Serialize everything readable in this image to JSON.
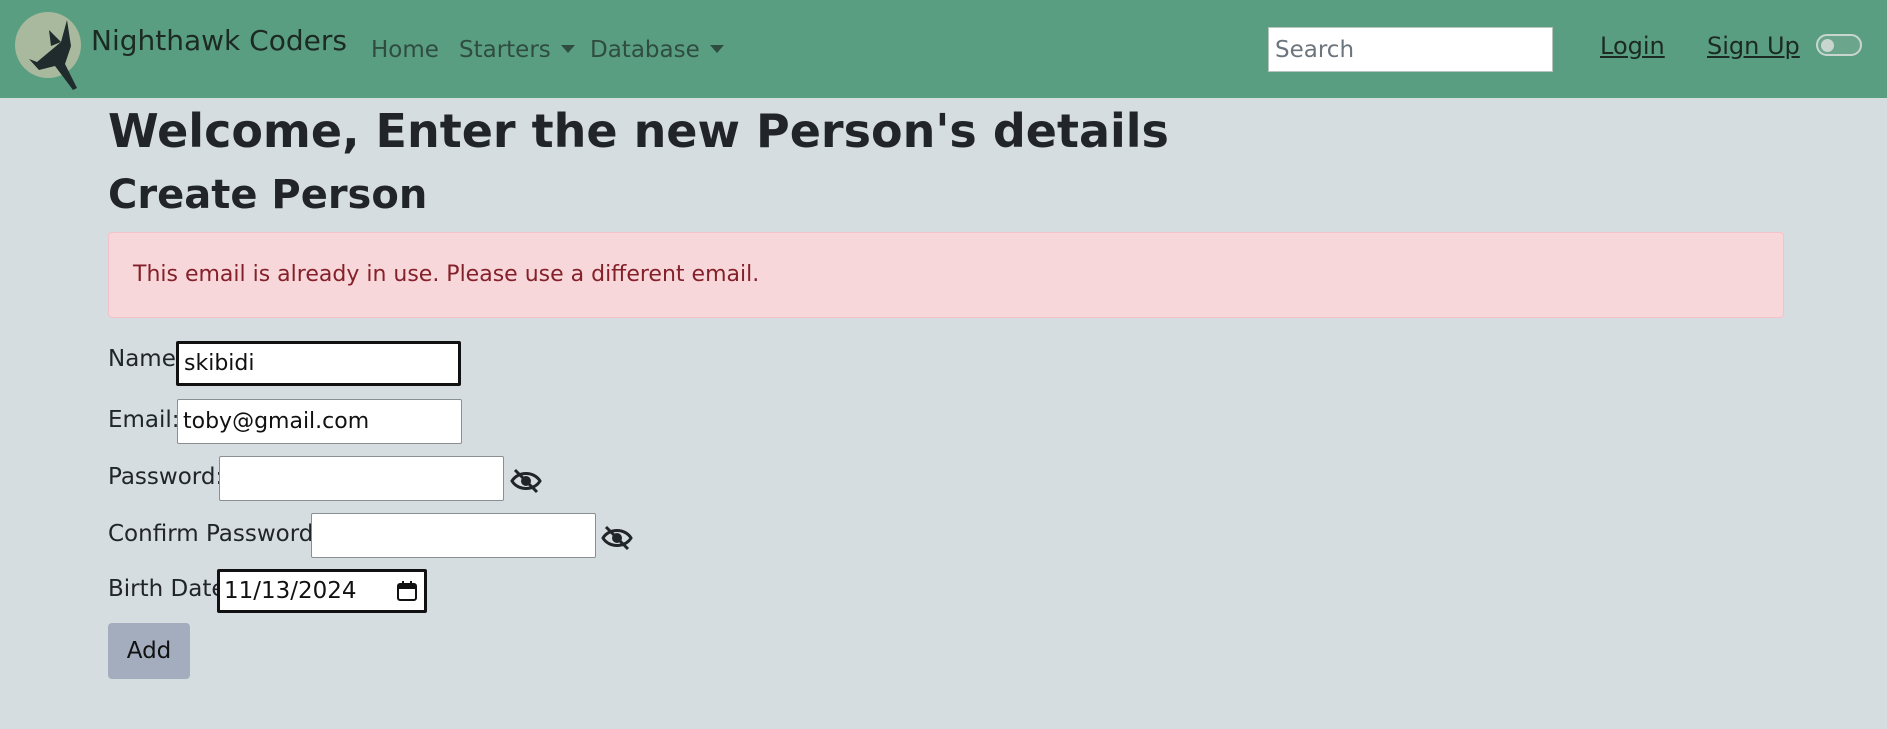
{
  "navbar": {
    "brand": "Nighthawk Coders",
    "logo_icon": "nighthawk-bird-icon",
    "links": {
      "home": "Home",
      "starters": "Starters",
      "database": "Database"
    },
    "search": {
      "placeholder": "Search",
      "value": ""
    },
    "login": "Login",
    "signup": "Sign Up",
    "theme_toggle": {
      "on": false
    }
  },
  "page": {
    "title": "Welcome, Enter the new Person's details",
    "section_title": "Create Person"
  },
  "alert": {
    "message": "This email is already in use. Please use a different email."
  },
  "form": {
    "name": {
      "label": "Name:",
      "value": "skibidi"
    },
    "email": {
      "label": "Email:",
      "value": "toby@gmail.com"
    },
    "password": {
      "label": "Password:",
      "value": ""
    },
    "confirm_password": {
      "label": "Confirm Password:",
      "value": ""
    },
    "birth_date": {
      "label": "Birth Date:",
      "value": "11/13/2024"
    },
    "submit": "Add"
  },
  "colors": {
    "navbar_bg": "#5a9e82",
    "page_bg": "#d5dde1",
    "alert_bg": "#f8d7da",
    "alert_text": "#842029",
    "button_bg": "#a3adbe"
  }
}
